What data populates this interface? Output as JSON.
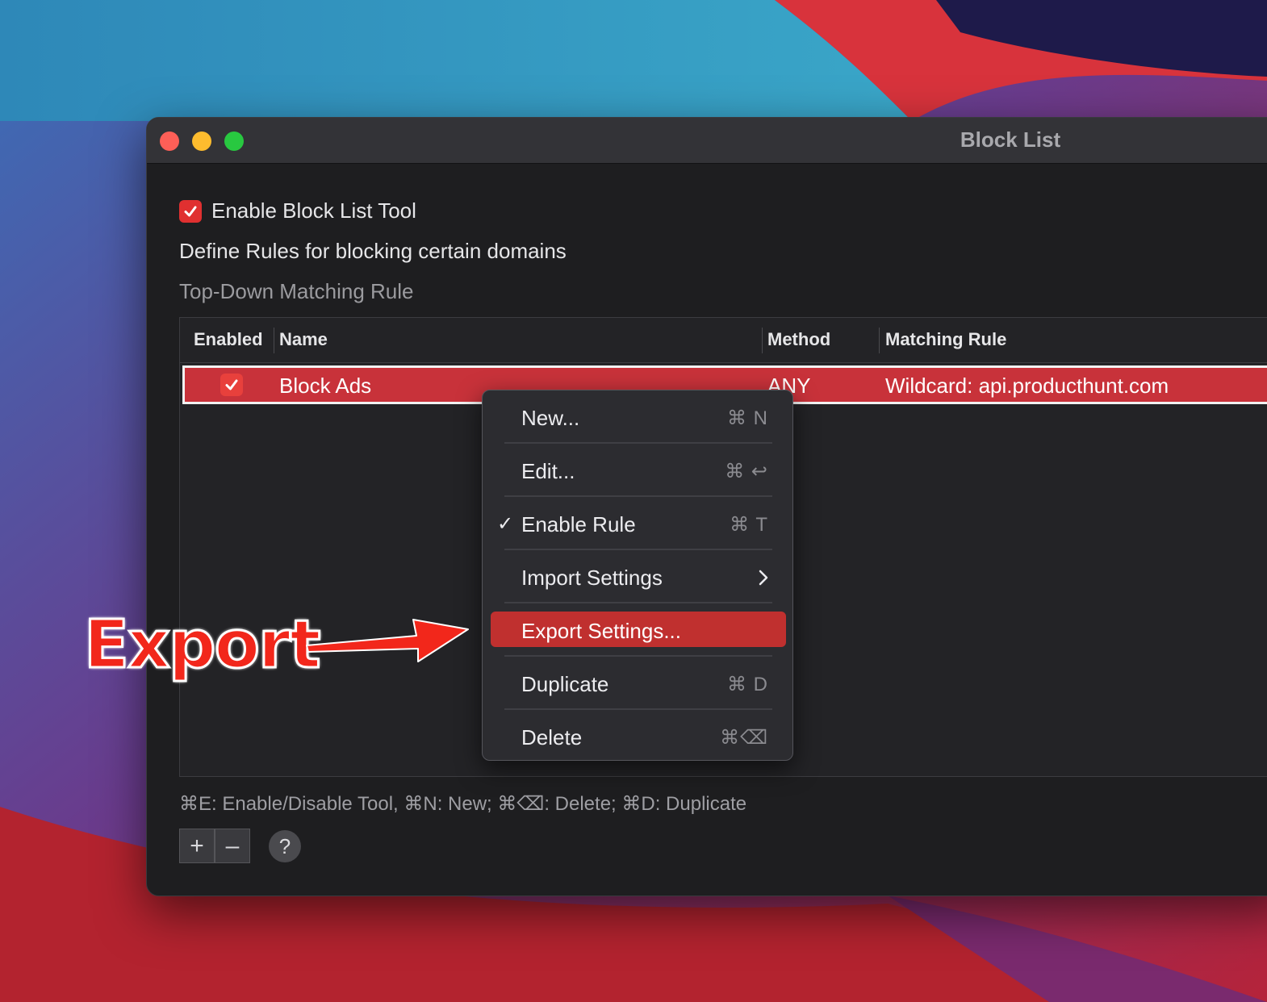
{
  "window": {
    "title": "Block List"
  },
  "settings": {
    "enable_tool_label": "Enable Block List Tool",
    "enable_tool_checked": true,
    "description": "Define Rules for blocking certain domains",
    "subdescription": "Top-Down Matching Rule"
  },
  "table": {
    "columns": [
      "Enabled",
      "Name",
      "Method",
      "Matching Rule"
    ],
    "rows": [
      {
        "enabled": true,
        "name": "Block Ads",
        "method": "ANY",
        "rule": "Wildcard: api.producthunt.com"
      }
    ]
  },
  "context_menu": {
    "items": [
      {
        "label": "New...",
        "shortcut": "⌘ N"
      },
      {
        "label": "Edit...",
        "shortcut": "⌘ ↩"
      },
      {
        "label": "Enable Rule",
        "shortcut": "⌘ T",
        "checked": true
      },
      {
        "label": "Import Settings",
        "submenu": true
      },
      {
        "label": "Export Settings...",
        "highlighted": true
      },
      {
        "label": "Duplicate",
        "shortcut": "⌘ D"
      },
      {
        "label": "Delete",
        "shortcut": "⌘⌫"
      }
    ]
  },
  "footer": {
    "hint": "⌘E: Enable/Disable Tool, ⌘N: New; ⌘⌫: Delete; ⌘D: Duplicate",
    "add_label": "+",
    "remove_label": "–",
    "help_label": "?"
  },
  "annotation": {
    "text": "Export"
  },
  "colors": {
    "accent": "#c0302f",
    "checkbox": "#e03030",
    "annotation": "#f2271b"
  }
}
